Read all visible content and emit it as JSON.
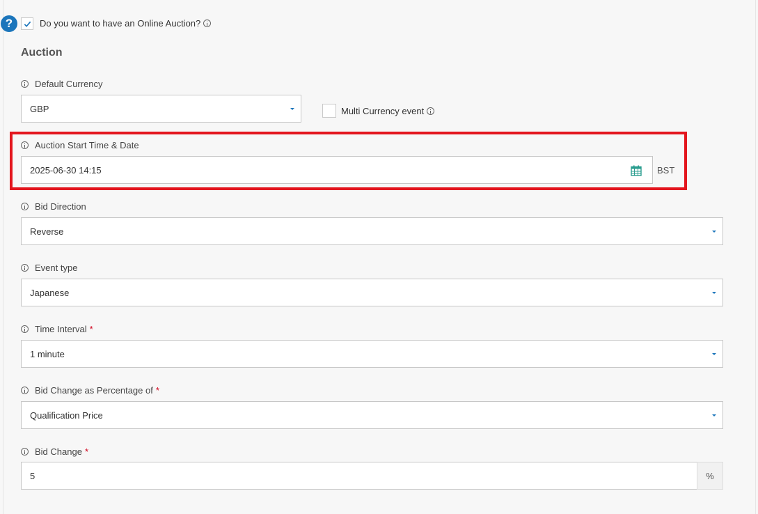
{
  "online_auction": {
    "question": "Do you want to have an Online Auction?",
    "checked": true,
    "help_badge": "?"
  },
  "section_title": "Auction",
  "default_currency": {
    "label": "Default Currency",
    "value": "GBP"
  },
  "multi_currency": {
    "label": "Multi Currency event",
    "checked": false
  },
  "start_time": {
    "label": "Auction Start Time & Date",
    "value": "2025-06-30 14:15",
    "timezone": "BST"
  },
  "bid_direction": {
    "label": "Bid Direction",
    "value": "Reverse"
  },
  "event_type": {
    "label": "Event type",
    "value": "Japanese"
  },
  "time_interval": {
    "label": "Time Interval",
    "required_mark": "*",
    "value": "1 minute"
  },
  "bid_change_pct": {
    "label": "Bid Change as Percentage of",
    "required_mark": "*",
    "value": "Qualification Price"
  },
  "bid_change": {
    "label": "Bid Change",
    "required_mark": "*",
    "value": "5",
    "unit": "%"
  },
  "colors": {
    "accent": "#1b75bb",
    "highlight": "#e3161e",
    "required": "#d0021b",
    "calendar": "#2a9d8f"
  }
}
